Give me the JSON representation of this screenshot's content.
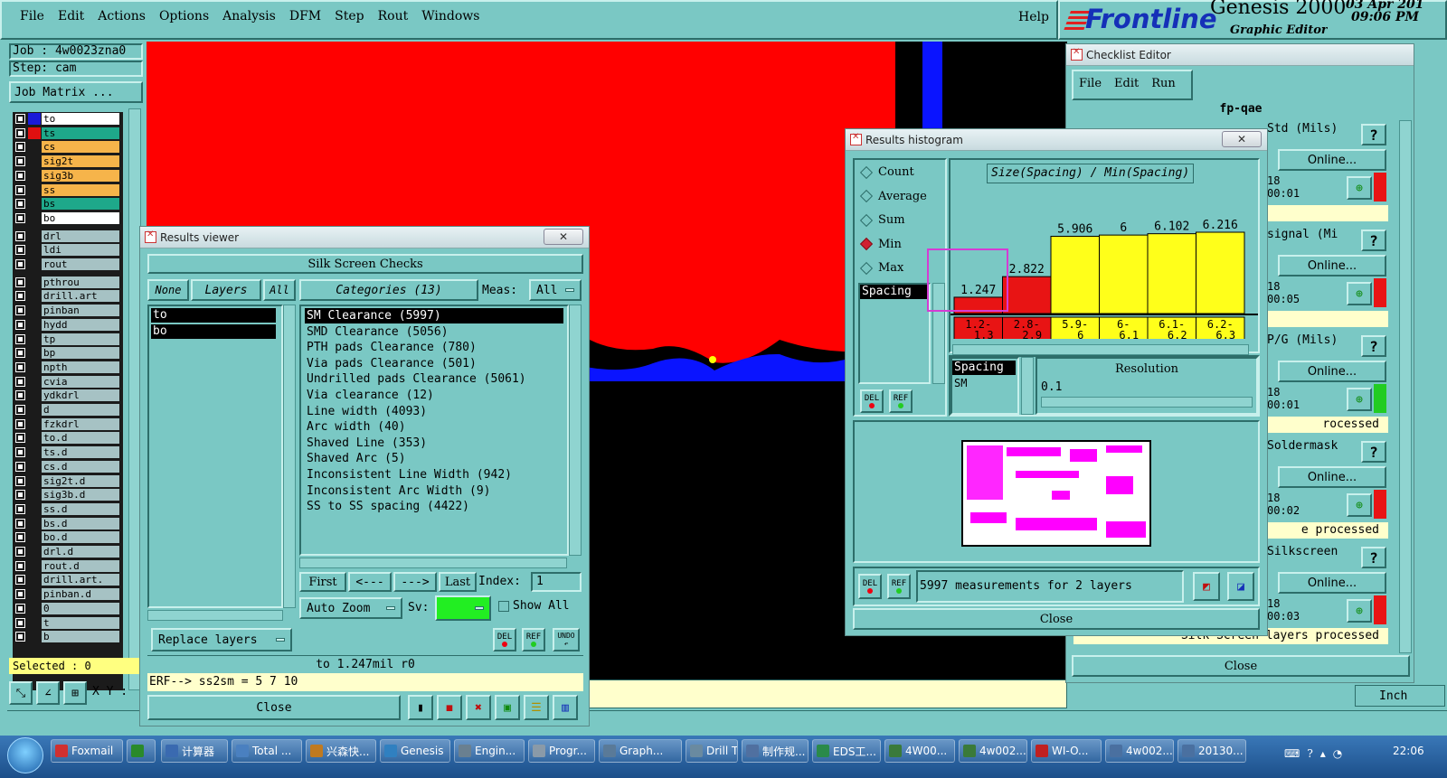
{
  "menubar": {
    "items": [
      "File",
      "Edit",
      "Actions",
      "Options",
      "Analysis",
      "DFM",
      "Step",
      "Rout",
      "Windows"
    ],
    "help": "Help"
  },
  "brand": {
    "logo": "Frontline",
    "product": "Genesis 2000",
    "subtitle": "Graphic Editor",
    "date": "03 Apr 201",
    "time": "09:06 PM"
  },
  "job": {
    "job_label": "Job : 4w0023zna0",
    "step_label": "Step: cam",
    "matrix_button": "Job Matrix ..."
  },
  "layers": [
    {
      "name": "to",
      "color": "#ffffff",
      "swatch": "#1a1ad8"
    },
    {
      "name": "ts",
      "color": "#1ea88a",
      "swatch": "#e01010"
    },
    {
      "name": "cs",
      "color": "#f6b44a",
      "swatch": "#1b1b1b"
    },
    {
      "name": "sig2t",
      "color": "#f6b44a",
      "swatch": "#1b1b1b"
    },
    {
      "name": "sig3b",
      "color": "#f6b44a",
      "swatch": "#1b1b1b"
    },
    {
      "name": "ss",
      "color": "#f6b44a",
      "swatch": "#1b1b1b"
    },
    {
      "name": "bs",
      "color": "#1ea88a",
      "swatch": "#1b1b1b"
    },
    {
      "name": "bo",
      "color": "#ffffff",
      "swatch": "#1b1b1b"
    },
    {
      "name": "drl",
      "color": "#a6c2c4",
      "swatch": "#1b1b1b"
    },
    {
      "name": "ldi",
      "color": "#a6c2c4",
      "swatch": "#1b1b1b"
    },
    {
      "name": "rout",
      "color": "#a6c2c4",
      "swatch": "#1b1b1b"
    },
    {
      "name": "pthrou",
      "color": "#a6c2c4",
      "swatch": "#1b1b1b"
    },
    {
      "name": "drill.art",
      "color": "#a6c2c4",
      "swatch": "#1b1b1b"
    },
    {
      "name": "pinban",
      "color": "#a6c2c4",
      "swatch": "#1b1b1b"
    },
    {
      "name": "hydd",
      "color": "#a6c2c4",
      "swatch": "#1b1b1b"
    },
    {
      "name": "tp",
      "color": "#a6c2c4",
      "swatch": "#1b1b1b"
    },
    {
      "name": "bp",
      "color": "#a6c2c4",
      "swatch": "#1b1b1b"
    },
    {
      "name": "npth",
      "color": "#a6c2c4",
      "swatch": "#1b1b1b"
    },
    {
      "name": "cvia",
      "color": "#a6c2c4",
      "swatch": "#1b1b1b"
    },
    {
      "name": "ydkdrl",
      "color": "#a6c2c4",
      "swatch": "#1b1b1b"
    },
    {
      "name": "d",
      "color": "#a6c2c4",
      "swatch": "#1b1b1b"
    },
    {
      "name": "fzkdrl",
      "color": "#a6c2c4",
      "swatch": "#1b1b1b"
    },
    {
      "name": "to.d",
      "color": "#a6c2c4",
      "swatch": "#1b1b1b"
    },
    {
      "name": "ts.d",
      "color": "#a6c2c4",
      "swatch": "#1b1b1b"
    },
    {
      "name": "cs.d",
      "color": "#a6c2c4",
      "swatch": "#1b1b1b"
    },
    {
      "name": "sig2t.d",
      "color": "#a6c2c4",
      "swatch": "#1b1b1b"
    },
    {
      "name": "sig3b.d",
      "color": "#a6c2c4",
      "swatch": "#1b1b1b"
    },
    {
      "name": "ss.d",
      "color": "#a6c2c4",
      "swatch": "#1b1b1b"
    },
    {
      "name": "bs.d",
      "color": "#a6c2c4",
      "swatch": "#1b1b1b"
    },
    {
      "name": "bo.d",
      "color": "#a6c2c4",
      "swatch": "#1b1b1b"
    },
    {
      "name": "drl.d",
      "color": "#a6c2c4",
      "swatch": "#1b1b1b"
    },
    {
      "name": "rout.d",
      "color": "#a6c2c4",
      "swatch": "#1b1b1b"
    },
    {
      "name": "drill.art.",
      "color": "#a6c2c4",
      "swatch": "#1b1b1b"
    },
    {
      "name": "pinban.d",
      "color": "#a6c2c4",
      "swatch": "#1b1b1b"
    },
    {
      "name": "0",
      "color": "#a6c2c4",
      "swatch": "#1b1b1b"
    },
    {
      "name": "t",
      "color": "#a6c2c4",
      "swatch": "#1b1b1b"
    },
    {
      "name": "b",
      "color": "#a6c2c4",
      "swatch": "#1b1b1b"
    }
  ],
  "selected_label": "Selected : 0",
  "xy_label": "X Y :",
  "results_viewer": {
    "title": "Results viewer",
    "header": "Silk Screen Checks",
    "none_btn": "None",
    "layers_btn": "Layers",
    "all_btn": "All",
    "categories_btn": "Categories (13)",
    "meas_label": "Meas:",
    "meas_value": "All",
    "layer_list": [
      "to",
      "bo"
    ],
    "categories": [
      "SM Clearance (5997)",
      "SMD Clearance (5056)",
      "PTH pads Clearance (780)",
      "Via pads Clearance (501)",
      "Undrilled pads Clearance (5061)",
      "Via clearance (12)",
      "Line width (4093)",
      "Arc width (40)",
      "Shaved Line (353)",
      "Shaved Arc (5)",
      "Inconsistent Line Width (942)",
      "Inconsistent Arc Width (9)",
      "SS to SS spacing (4422)"
    ],
    "first_btn": "First",
    "prev_btn": "<---",
    "next_btn": "--->",
    "last_btn": "Last",
    "index_label": "Index:",
    "index_value": "1",
    "autozoom_btn": "Auto Zoom",
    "sv_label": "Sv:",
    "showall_label": "Show All",
    "replace_btn": "Replace layers",
    "del_btn": "DEL",
    "ref_btn": "REF",
    "undo_btn": "UNDO",
    "status": "to 1.247mil   r0",
    "erf": "ERF--> ss2sm = 5 7 10",
    "close_btn": "Close"
  },
  "histogram": {
    "title": "Results histogram",
    "modes": [
      "Count",
      "Average",
      "Sum",
      "Min",
      "Max"
    ],
    "selected_mode": "Min",
    "list_items": [
      "Spacing"
    ],
    "chart_title": "Size(Spacing) / Min(Spacing)",
    "resolution_label": "Resolution",
    "resolution_value": "0.1",
    "spacing_list": [
      "Spacing",
      "SM"
    ],
    "measure_text": "5997 measurements for 2 layers",
    "close_btn": "Close",
    "del_btn": "DEL",
    "ref_btn": "REF"
  },
  "chart_data": {
    "type": "bar",
    "title": "Size(Spacing) / Min(Spacing)",
    "categories": [
      "1.2-1.3",
      "2.8-2.9",
      "5.9-6",
      "6-6.1",
      "6.1-6.2",
      "6.2-6.3"
    ],
    "values": [
      1.247,
      2.822,
      5.906,
      6,
      6.102,
      6.216
    ],
    "value_labels": [
      "1.247",
      "2.822",
      "5.906",
      "6",
      "6.102",
      "6.216"
    ],
    "bar_colors": [
      "#e81414",
      "#e81414",
      "#ffff1a",
      "#ffff1a",
      "#ffff1a",
      "#ffff1a"
    ],
    "ylim": [
      0,
      6.216
    ]
  },
  "checklist": {
    "title": "Checklist Editor",
    "menu": [
      "File",
      "Edit",
      "Run"
    ],
    "name": "fp-qae",
    "rows": [
      {
        "label": "Std (Mils)",
        "online": "Online...",
        "num": "18",
        "time": "00:01",
        "flag": "#e81414",
        "status": ""
      },
      {
        "label": "signal (Mi",
        "online": "Online...",
        "num": "18",
        "time": "00:05",
        "flag": "#e81414",
        "status": ""
      },
      {
        "label": "P/G (Mils)",
        "online": "Online...",
        "num": "18",
        "time": "00:01",
        "flag": "#22cc22",
        "status": "rocessed"
      },
      {
        "label": "Soldermask",
        "online": "Online...",
        "num": "18",
        "time": "00:02",
        "flag": "#e81414",
        "status": "e processed"
      },
      {
        "label": "Silkscreen",
        "online": "Online...",
        "num": "18",
        "time": "00:03",
        "flag": "#e81414",
        "status": "Silk Screen layers processed"
      }
    ],
    "close_btn": "Close",
    "units": "Inch"
  },
  "taskbar": {
    "items": [
      "Foxmail",
      "",
      "计算器",
      "Total ...",
      "兴森快...",
      "Genesis",
      "Engin...",
      "Progr...",
      "Graph...",
      "Drill T...",
      "制作规...",
      "EDS工...",
      "4W00...",
      "4w002...",
      "WI-O...",
      "4w002...",
      "20130..."
    ],
    "clock": "22:06"
  }
}
